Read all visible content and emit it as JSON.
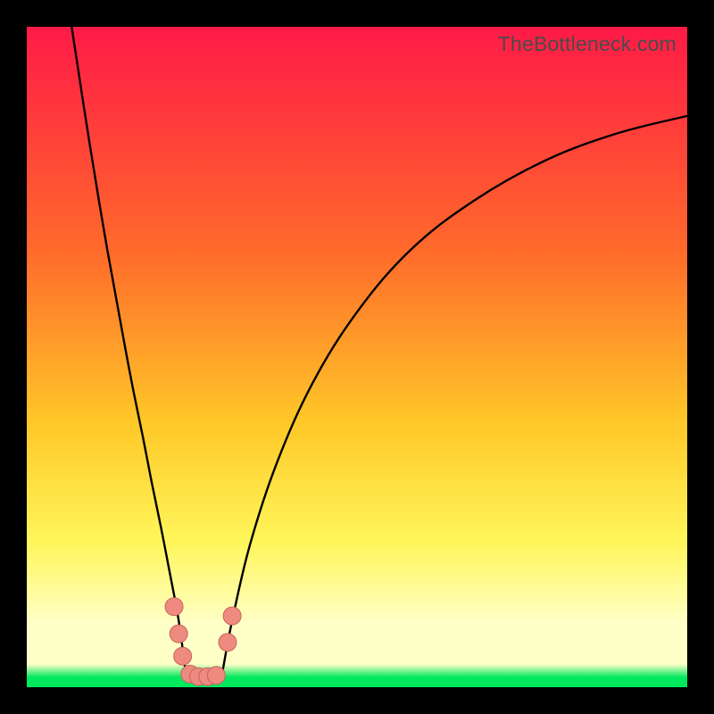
{
  "watermark": "TheBottleneck.com",
  "colors": {
    "top": "#ff1a47",
    "mid1": "#ff6a2b",
    "mid2": "#ffc828",
    "mid3": "#fff65a",
    "pale": "#ffffc8",
    "green": "#00e85e",
    "curve": "#000000",
    "marker_fill": "#ef8a80",
    "marker_stroke": "#c4665d"
  },
  "chart_data": {
    "type": "line",
    "title": "",
    "xlabel": "",
    "ylabel": "",
    "xlim": [
      0,
      100
    ],
    "ylim": [
      0,
      100
    ],
    "note": "Bottleneck-style V-curve. No axis ticks or numeric labels are rendered in the source image; x and y are in percent of the plot area (0 at left/bottom, 100 at right/top). Values are read off pixel positions.",
    "series": [
      {
        "name": "left-branch",
        "x": [
          6.8,
          9.5,
          12.2,
          14.9,
          16.2,
          17.6,
          18.9,
          20.3,
          21.6,
          23.0,
          24.0
        ],
        "y": [
          100.0,
          82.4,
          66.2,
          51.4,
          44.6,
          37.8,
          31.1,
          24.3,
          17.6,
          10.1,
          2.7
        ]
      },
      {
        "name": "right-branch",
        "x": [
          29.7,
          31.1,
          33.8,
          37.8,
          43.2,
          50.0,
          58.1,
          67.6,
          78.4,
          89.2,
          100.0
        ],
        "y": [
          2.7,
          10.1,
          21.6,
          33.8,
          45.9,
          56.8,
          66.2,
          73.6,
          79.7,
          83.8,
          86.5
        ]
      },
      {
        "name": "valley-floor",
        "x": [
          24.0,
          25.0,
          26.4,
          27.7,
          28.4,
          29.7
        ],
        "y": [
          2.7,
          1.4,
          1.4,
          1.4,
          1.4,
          2.7
        ]
      }
    ],
    "markers": {
      "name": "highlighted-points",
      "points": [
        {
          "x": 22.3,
          "y": 12.2
        },
        {
          "x": 23.0,
          "y": 8.1
        },
        {
          "x": 23.6,
          "y": 4.7
        },
        {
          "x": 24.7,
          "y": 2.0
        },
        {
          "x": 26.0,
          "y": 1.6
        },
        {
          "x": 27.4,
          "y": 1.6
        },
        {
          "x": 28.7,
          "y": 1.8
        },
        {
          "x": 30.4,
          "y": 6.8
        },
        {
          "x": 31.1,
          "y": 10.8
        }
      ],
      "radius_pct": 1.35
    },
    "gradient_stops": [
      {
        "offset": 0.0,
        "key": "top"
      },
      {
        "offset": 0.34,
        "key": "mid1"
      },
      {
        "offset": 0.6,
        "key": "mid2"
      },
      {
        "offset": 0.78,
        "key": "mid3"
      },
      {
        "offset": 0.905,
        "key": "pale"
      },
      {
        "offset": 0.965,
        "key": "pale"
      },
      {
        "offset": 0.985,
        "key": "green"
      },
      {
        "offset": 1.0,
        "key": "green"
      }
    ]
  }
}
